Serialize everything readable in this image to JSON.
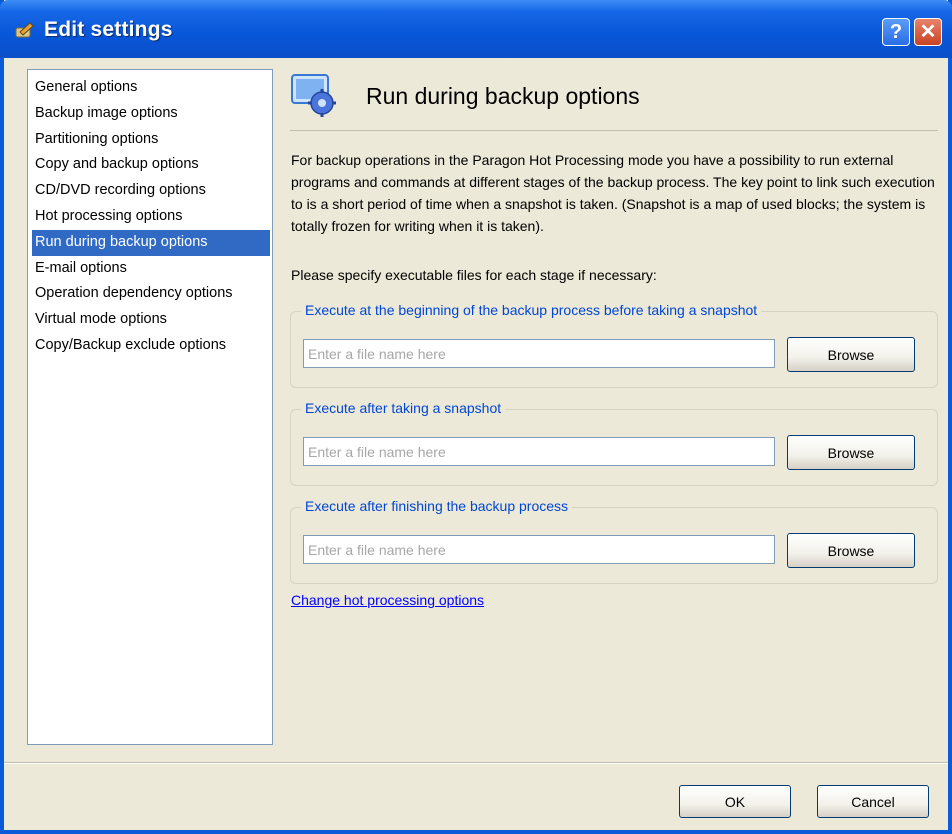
{
  "window": {
    "title": "Edit settings",
    "help_label": "?",
    "close_label": "✕"
  },
  "sidebar": {
    "items": [
      {
        "label": "General options",
        "selected": false
      },
      {
        "label": "Backup image options",
        "selected": false
      },
      {
        "label": "Partitioning options",
        "selected": false
      },
      {
        "label": "Copy and backup options",
        "selected": false
      },
      {
        "label": "CD/DVD recording options",
        "selected": false
      },
      {
        "label": "Hot processing options",
        "selected": false
      },
      {
        "label": "Run during backup options",
        "selected": true
      },
      {
        "label": "E-mail options",
        "selected": false
      },
      {
        "label": "Operation dependency options",
        "selected": false
      },
      {
        "label": "Virtual mode options",
        "selected": false
      },
      {
        "label": "Copy/Backup exclude options",
        "selected": false
      }
    ]
  },
  "main": {
    "title": "Run during backup options",
    "description": "For backup operations in the Paragon Hot Processing mode you have a possibility to run external programs and commands at different stages of the backup process. The key point to link such execution to is a short period of time when a snapshot is taken. (Snapshot is a map of used blocks; the system is totally frozen for writing when it is taken).",
    "specify_text": "Please specify executable files for each stage if necessary:",
    "groups": [
      {
        "legend": "Execute at the beginning of the backup process before taking a snapshot",
        "placeholder": "Enter a file name here",
        "value": "",
        "browse_label": "Browse"
      },
      {
        "legend": "Execute after taking a snapshot",
        "placeholder": "Enter a file name here",
        "value": "",
        "browse_label": "Browse"
      },
      {
        "legend": "Execute after finishing the backup process",
        "placeholder": "Enter a file name here",
        "value": "",
        "browse_label": "Browse"
      }
    ],
    "link_text": "Change hot processing options"
  },
  "footer": {
    "ok_label": "OK",
    "cancel_label": "Cancel"
  },
  "colors": {
    "titlebar": "#0856d9",
    "selection": "#316ac5",
    "legend": "#0046d5",
    "link": "#0000ff"
  }
}
